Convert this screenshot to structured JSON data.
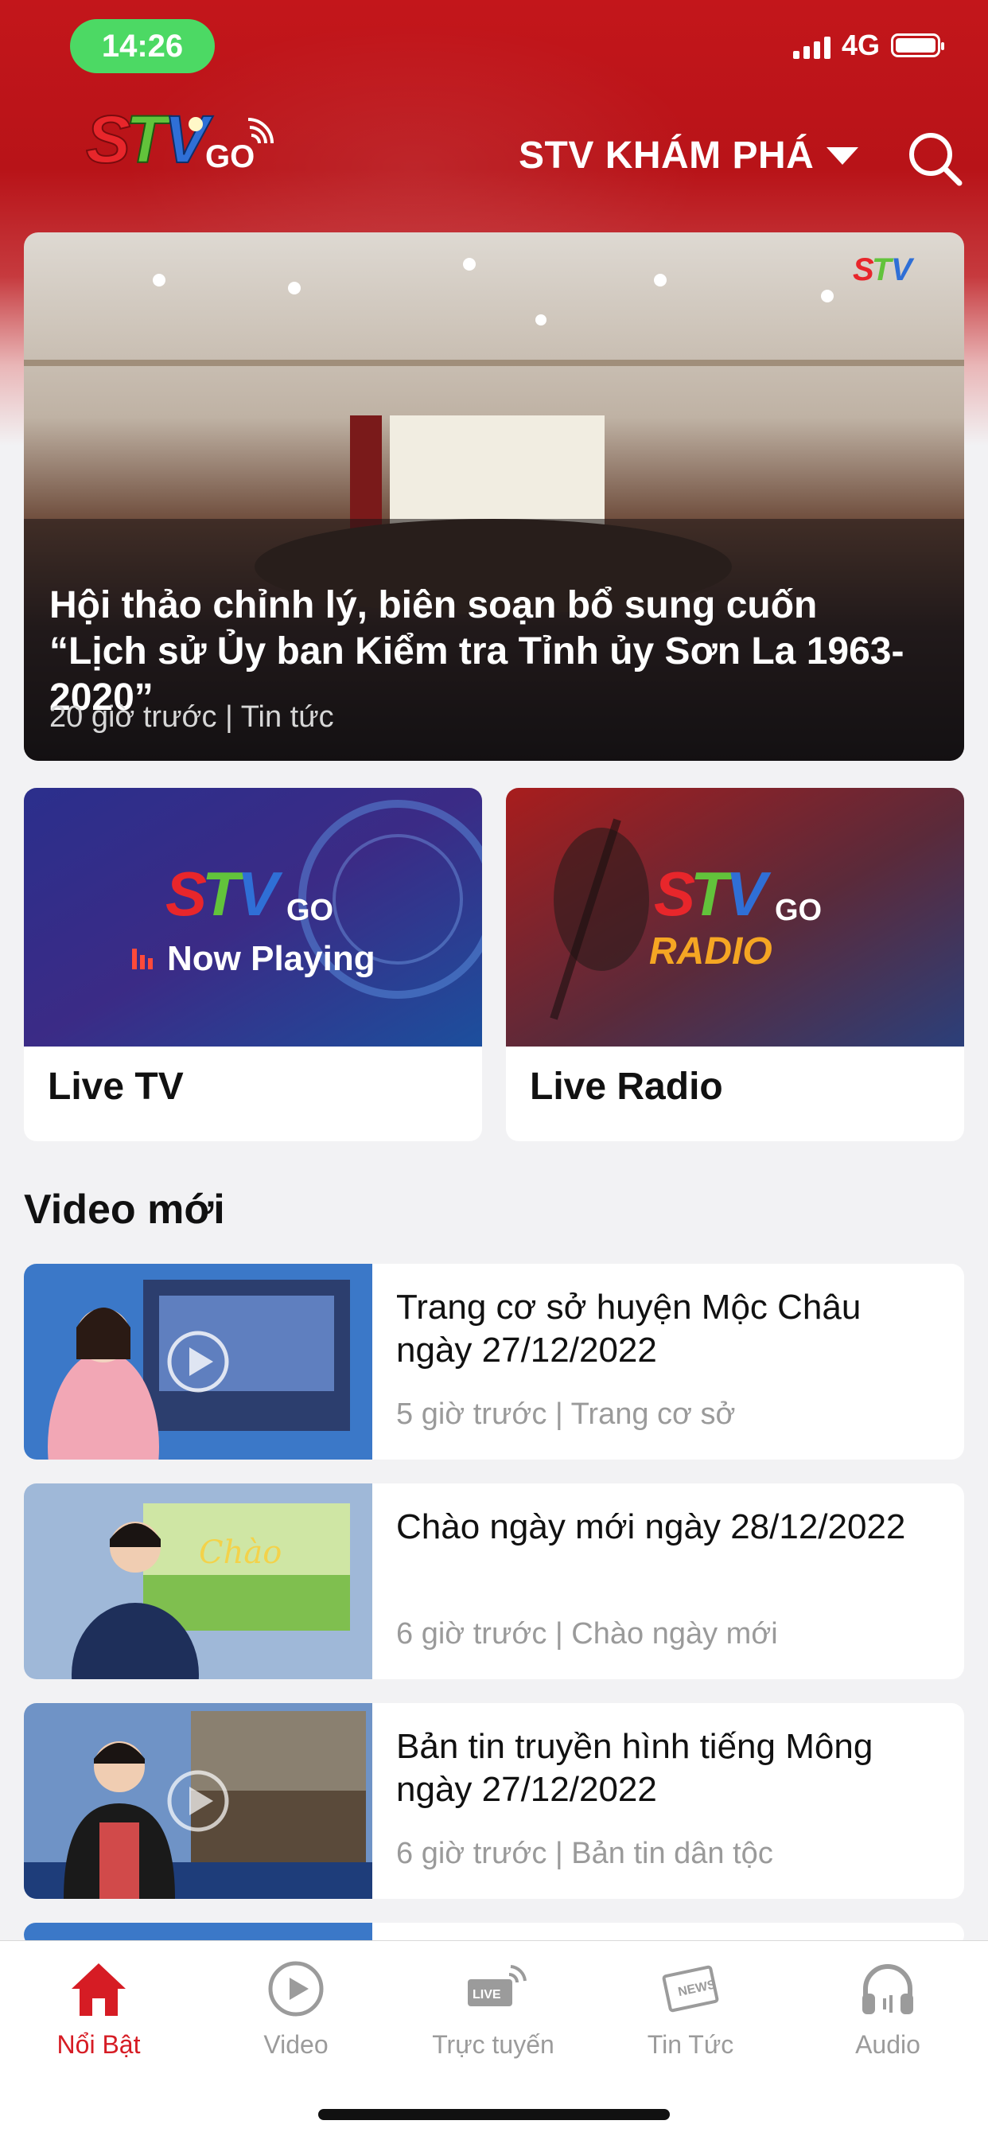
{
  "status_bar": {
    "time": "14:26",
    "network": "4G"
  },
  "header": {
    "channel_label": "STV KHÁM PHÁ"
  },
  "hero": {
    "title": "Hội thảo chỉnh lý, biên soạn bổ sung cuốn “Lịch sử Ủy ban Kiểm tra Tỉnh ủy Sơn La 1963-2020”",
    "meta": "20 giờ trước | Tin tức"
  },
  "live_tv": {
    "thumb_text": "Now Playing",
    "label": "Live TV"
  },
  "live_radio": {
    "thumb_text": "RADIO",
    "label": "Live Radio"
  },
  "section": {
    "title": "Video mới"
  },
  "videos": [
    {
      "title": "Trang cơ sở huyện Mộc Châu ngày 27/12/2022",
      "meta": "5 giờ trước | Trang cơ sở"
    },
    {
      "title": "Chào ngày mới ngày 28/12/2022",
      "meta": "6 giờ trước | Chào ngày mới"
    },
    {
      "title": "Bản tin truyền hình tiếng Mông ngày 27/12/2022",
      "meta": "6 giờ trước | Bản tin dân tộc"
    }
  ],
  "tabs": [
    {
      "label": "Nổi Bật",
      "icon": "home-icon",
      "active": true
    },
    {
      "label": "Video",
      "icon": "play-circle-icon",
      "active": false
    },
    {
      "label": "Trực tuyến",
      "icon": "live-icon",
      "active": false
    },
    {
      "label": "Tin Tức",
      "icon": "news-icon",
      "active": false
    },
    {
      "label": "Audio",
      "icon": "headphones-icon",
      "active": false
    }
  ],
  "colors": {
    "brand_red": "#c3161b",
    "active_tab": "#d61c24",
    "status_pill": "#4cd964"
  }
}
